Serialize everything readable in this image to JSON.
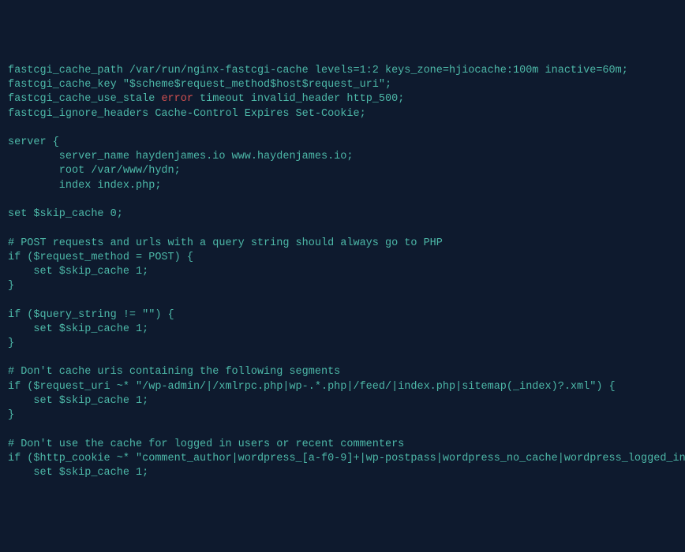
{
  "lines": [
    {
      "text": "fastcgi_cache_path /var/run/nginx-fastcgi-cache levels=1:2 keys_zone=hjiocache:100m inactive=60m;"
    },
    {
      "text": "fastcgi_cache_key \"$scheme$request_method$host$request_uri\";"
    },
    {
      "text_before": "fastcgi_cache_use_stale ",
      "error": "error",
      "text_after": " timeout invalid_header http_500;"
    },
    {
      "text": "fastcgi_ignore_headers Cache-Control Expires Set-Cookie;"
    },
    {
      "text": ""
    },
    {
      "text": "server {"
    },
    {
      "text": "        server_name haydenjames.io www.haydenjames.io;"
    },
    {
      "text": "        root /var/www/hydn;"
    },
    {
      "text": "        index index.php;"
    },
    {
      "text": ""
    },
    {
      "text": "set $skip_cache 0;"
    },
    {
      "text": ""
    },
    {
      "text": "# POST requests and urls with a query string should always go to PHP"
    },
    {
      "text": "if ($request_method = POST) {"
    },
    {
      "text": "    set $skip_cache 1;"
    },
    {
      "text": "}"
    },
    {
      "text": ""
    },
    {
      "text": "if ($query_string != \"\") {"
    },
    {
      "text": "    set $skip_cache 1;"
    },
    {
      "text": "}"
    },
    {
      "text": ""
    },
    {
      "text": "# Don't cache uris containing the following segments"
    },
    {
      "text": "if ($request_uri ~* \"/wp-admin/|/xmlrpc.php|wp-.*.php|/feed/|index.php|sitemap(_index)?.xml\") {"
    },
    {
      "text": "    set $skip_cache 1;"
    },
    {
      "text": "}"
    },
    {
      "text": ""
    },
    {
      "text": "# Don't use the cache for logged in users or recent commenters"
    },
    {
      "text": "if ($http_cookie ~* \"comment_author|wordpress_[a-f0-9]+|wp-postpass|wordpress_no_cache|wordpress_logged_in\")"
    },
    {
      "text": "    set $skip_cache 1;"
    }
  ]
}
